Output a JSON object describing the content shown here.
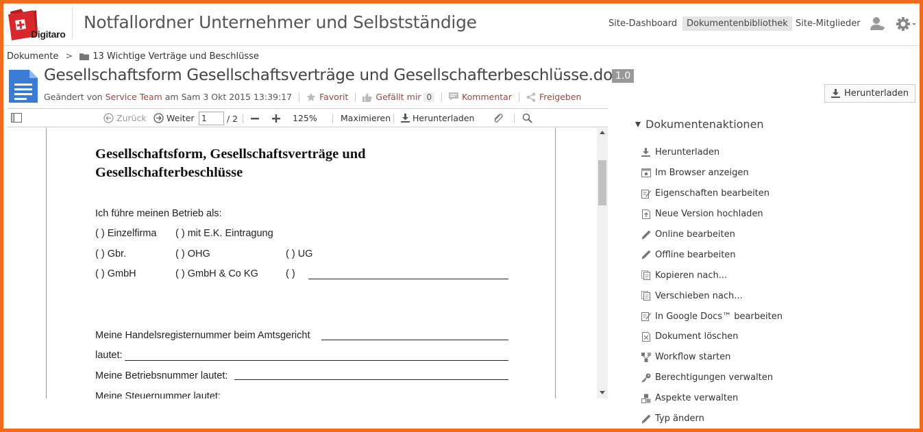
{
  "header": {
    "logo_text": "Digitaro",
    "site_title": "Notfallordner Unternehmer und Selbstständige",
    "nav": [
      {
        "label": "Site-Dashboard",
        "active": false
      },
      {
        "label": "Dokumentenbibliothek",
        "active": true
      },
      {
        "label": "Site-Mitglieder",
        "active": false
      }
    ],
    "icons": [
      "user-add-icon",
      "gear-icon"
    ]
  },
  "breadcrumb": {
    "root": "Dokumente",
    "separator": ">",
    "folder": "13 Wichtige Verträge und Beschlüsse"
  },
  "document": {
    "title": "Gesellschaftsform Gesellschaftsverträge und Gesellschafterbeschlüsse.docx",
    "version": "1.0",
    "modified_prefix": "Geändert von",
    "modified_by": "Service Team",
    "modified_date": "am Sam 3 Okt 2015 13:39:17",
    "favorite": "Favorit",
    "like": "Gefällt mir",
    "like_count": "0",
    "comment": "Kommentar",
    "share": "Freigeben",
    "download_button": "Herunterladen"
  },
  "viewer": {
    "back": "Zurück",
    "next": "Weiter",
    "page_current": "1",
    "page_total": "/ 2",
    "zoom": "125%",
    "maximize": "Maximieren",
    "download": "Herunterladen"
  },
  "pdf": {
    "heading_line1": "Gesellschaftsform, Gesellschaftsverträge und",
    "heading_line2": "Gesellschafterbeschlüsse",
    "intro": "Ich führe meinen Betrieb als:",
    "row1": [
      "(   ) Einzelfirma",
      "(   ) mit E.K. Eintragung"
    ],
    "row2": [
      "(   ) Gbr.",
      "(   )  OHG",
      "(   ) UG"
    ],
    "row3": [
      "(   ) GmbH",
      "(   ) GmbH & Co KG",
      "(   )"
    ],
    "hr_label": "Meine Handelsregisternummer beim Amtsgericht",
    "hr_label2": "lautet:",
    "betrieb_label": "Meine Betriebsnummer lautet:",
    "steuer_label": "Meine Steuernummer lautet:"
  },
  "panel": {
    "title": "Dokumentenaktionen",
    "actions": [
      {
        "label": "Herunterladen",
        "icon": "download-icon"
      },
      {
        "label": "Im Browser anzeigen",
        "icon": "browser-view-icon"
      },
      {
        "label": "Eigenschaften bearbeiten",
        "icon": "edit-properties-icon"
      },
      {
        "label": "Neue Version hochladen",
        "icon": "upload-icon"
      },
      {
        "label": "Online bearbeiten",
        "icon": "pencil-icon"
      },
      {
        "label": "Offline bearbeiten",
        "icon": "pencil-icon"
      },
      {
        "label": "Kopieren nach...",
        "icon": "copy-icon"
      },
      {
        "label": "Verschieben nach...",
        "icon": "move-icon"
      },
      {
        "label": "In Google Docs™ bearbeiten",
        "icon": "google-docs-icon"
      },
      {
        "label": "Dokument löschen",
        "icon": "delete-icon"
      },
      {
        "label": "Workflow starten",
        "icon": "workflow-icon"
      },
      {
        "label": "Berechtigungen verwalten",
        "icon": "key-icon"
      },
      {
        "label": "Aspekte verwalten",
        "icon": "aspects-icon"
      },
      {
        "label": "Typ ändern",
        "icon": "pencil-icon"
      }
    ]
  },
  "colors": {
    "frame": "#f26a1b",
    "link": "#a0443a",
    "logo_red": "#d9272e",
    "doc_blue": "#3a7bd5"
  }
}
